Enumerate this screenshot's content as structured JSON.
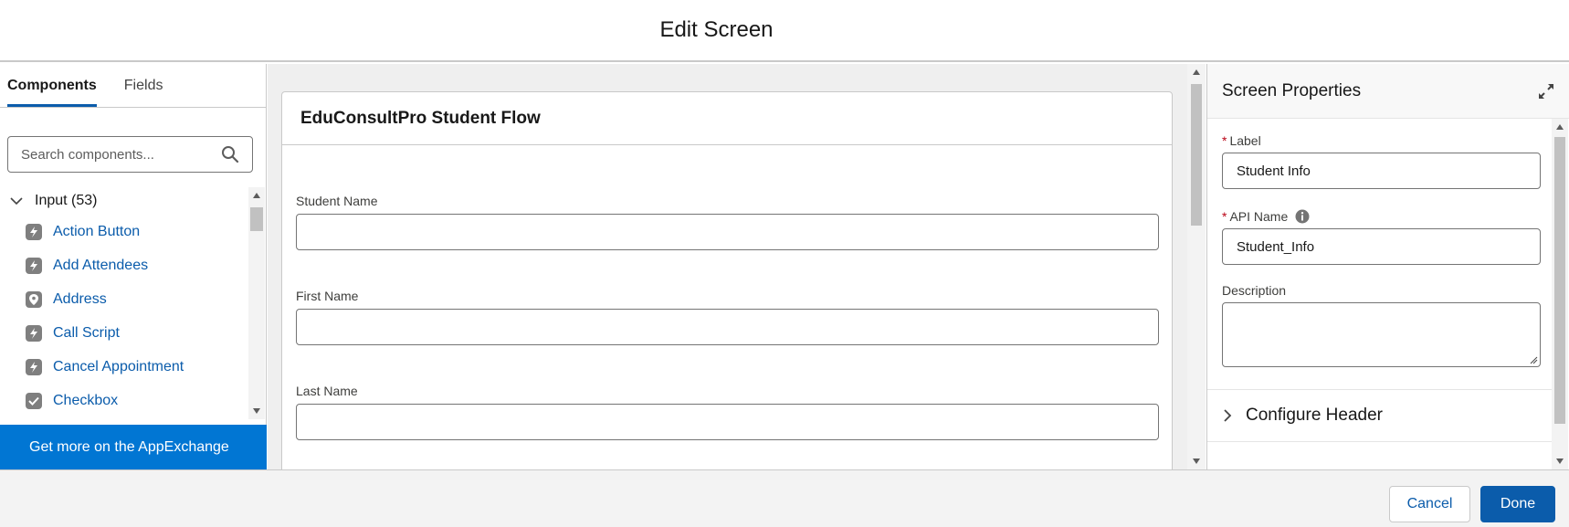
{
  "header": {
    "title": "Edit Screen"
  },
  "left_panel": {
    "tabs": [
      {
        "label": "Components",
        "active": true
      },
      {
        "label": "Fields",
        "active": false
      }
    ],
    "search": {
      "placeholder": "Search components..."
    },
    "section": {
      "label": "Input (53)",
      "expanded": true
    },
    "components": [
      {
        "label": "Action Button",
        "icon": "lightning-icon"
      },
      {
        "label": "Add Attendees",
        "icon": "lightning-icon"
      },
      {
        "label": "Address",
        "icon": "location-pin-icon"
      },
      {
        "label": "Call Script",
        "icon": "lightning-icon"
      },
      {
        "label": "Cancel Appointment",
        "icon": "lightning-icon"
      },
      {
        "label": "Checkbox",
        "icon": "checkbox-icon"
      }
    ],
    "appexchange_label": "Get more on the AppExchange"
  },
  "canvas": {
    "screen_title": "EduConsultPro Student Flow",
    "fields": [
      {
        "label": "Student Name",
        "value": ""
      },
      {
        "label": "First Name",
        "value": ""
      },
      {
        "label": "Last Name",
        "value": ""
      }
    ]
  },
  "properties": {
    "title": "Screen Properties",
    "label_field": {
      "label": "Label",
      "required_mark": "*",
      "value": "Student Info"
    },
    "api_name_field": {
      "label": "API Name",
      "required_mark": "*",
      "value": "Student_Info"
    },
    "description_field": {
      "label": "Description",
      "value": ""
    },
    "configure_header": "Configure Header"
  },
  "footer": {
    "cancel_label": "Cancel",
    "done_label": "Done"
  },
  "colors": {
    "brand": "#0b5cab",
    "appexchange": "#0176d3",
    "required": "#ba0517"
  }
}
